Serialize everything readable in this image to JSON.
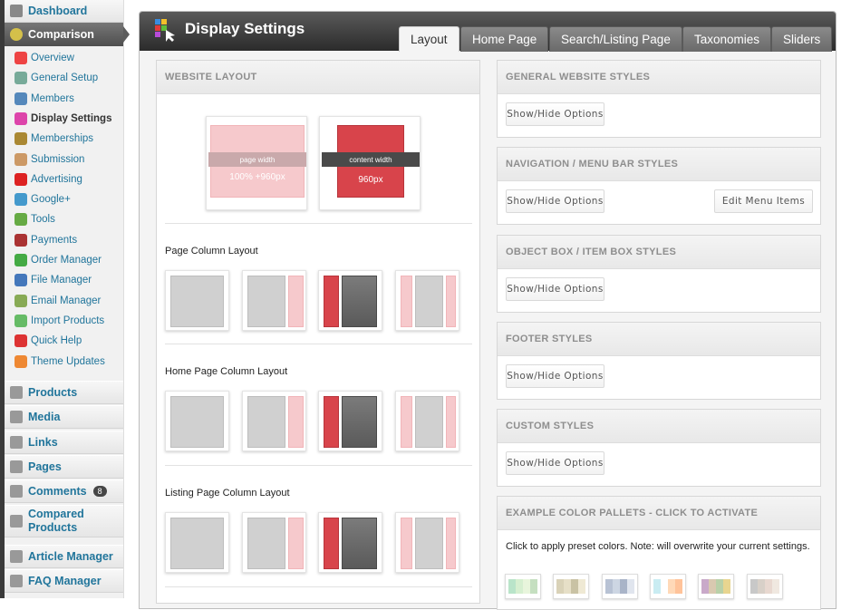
{
  "sidebar": {
    "top_items": [
      {
        "label": "Dashboard",
        "icon": "dashboard-icon"
      },
      {
        "label": "Comparison",
        "icon": "comparison-icon"
      }
    ],
    "sub_items": [
      {
        "label": "Overview",
        "icon": "overview-icon",
        "color": "#e44"
      },
      {
        "label": "General Setup",
        "icon": "tools-icon",
        "color": "#7a9"
      },
      {
        "label": "Members",
        "icon": "members-icon",
        "color": "#58b"
      },
      {
        "label": "Display Settings",
        "icon": "display-settings-icon",
        "color": "#d4a",
        "current": true
      },
      {
        "label": "Memberships",
        "icon": "memberships-icon",
        "color": "#a83"
      },
      {
        "label": "Submission",
        "icon": "submission-icon",
        "color": "#c96"
      },
      {
        "label": "Advertising",
        "icon": "advertising-icon",
        "color": "#d22"
      },
      {
        "label": "Google+",
        "icon": "google-icon",
        "color": "#49c"
      },
      {
        "label": "Tools",
        "icon": "tools-icon",
        "color": "#6a4"
      },
      {
        "label": "Payments",
        "icon": "payments-icon",
        "color": "#a33"
      },
      {
        "label": "Order Manager",
        "icon": "order-manager-icon",
        "color": "#4a4"
      },
      {
        "label": "File Manager",
        "icon": "file-manager-icon",
        "color": "#47b"
      },
      {
        "label": "Email Manager",
        "icon": "email-manager-icon",
        "color": "#8a5"
      },
      {
        "label": "Import Products",
        "icon": "import-products-icon",
        "color": "#6b6"
      },
      {
        "label": "Quick Help",
        "icon": "quick-help-icon",
        "color": "#d33"
      },
      {
        "label": "Theme Updates",
        "icon": "theme-updates-icon",
        "color": "#e83"
      }
    ],
    "bottom_items": [
      {
        "label": "Products",
        "icon": "products-icon"
      },
      {
        "label": "Media",
        "icon": "media-icon"
      },
      {
        "label": "Links",
        "icon": "links-icon"
      },
      {
        "label": "Pages",
        "icon": "pages-icon"
      },
      {
        "label": "Comments",
        "icon": "comments-icon",
        "badge": "8"
      },
      {
        "label": "Compared Products",
        "icon": "compared-products-icon"
      },
      {
        "label": "Article Manager",
        "icon": "article-manager-icon"
      },
      {
        "label": "FAQ Manager",
        "icon": "faq-manager-icon"
      }
    ]
  },
  "header": {
    "title": "Display Settings"
  },
  "tabs": [
    "Layout",
    "Home Page",
    "Search/Listing Page",
    "Taxonomies",
    "Sliders"
  ],
  "website_layout": {
    "title": "WEBSITE LAYOUT",
    "page_width_label": "page width",
    "page_width_value": "100% +960px",
    "content_width_label": "content width",
    "content_width_value": "960px",
    "page_column_label": "Page Column Layout",
    "home_column_label": "Home Page Column Layout",
    "listing_column_label": "Listing Page Column Layout"
  },
  "styles": [
    {
      "title": "GENERAL WEBSITE STYLES",
      "button": "Show/Hide Options"
    },
    {
      "title": "NAVIGATION / MENU BAR STYLES",
      "button": "Show/Hide Options",
      "extra_button": "Edit Menu Items"
    },
    {
      "title": "OBJECT BOX / ITEM BOX STYLES",
      "button": "Show/Hide Options"
    },
    {
      "title": "FOOTER STYLES",
      "button": "Show/Hide Options"
    },
    {
      "title": "CUSTOM STYLES",
      "button": "Show/Hide Options"
    }
  ],
  "pallets": {
    "title": "EXAMPLE COLOR PALLETS - CLICK TO ACTIVATE",
    "note": "Click to apply preset colors. Note: will overwrite your current settings.",
    "swatches": [
      [
        "#b9e4c9",
        "#d6efd0",
        "#e8f5dc",
        "#c5dfc0"
      ],
      [
        "#d9d2b8",
        "#e6dfc7",
        "#c9c2a4",
        "#efe9d4"
      ],
      [
        "#b8c2d4",
        "#cdd6e3",
        "#a9b4c8",
        "#e0e5ee"
      ],
      [
        "#c9ecf2",
        "#ffffff",
        "#ffd9b8",
        "#ffc39a"
      ],
      [
        "#c9a9c9",
        "#d9c9b0",
        "#b9d0a8",
        "#e8d590"
      ],
      [
        "#c8c8c8",
        "#d8d0c8",
        "#e8d8d0",
        "#f0e8e0"
      ]
    ]
  }
}
